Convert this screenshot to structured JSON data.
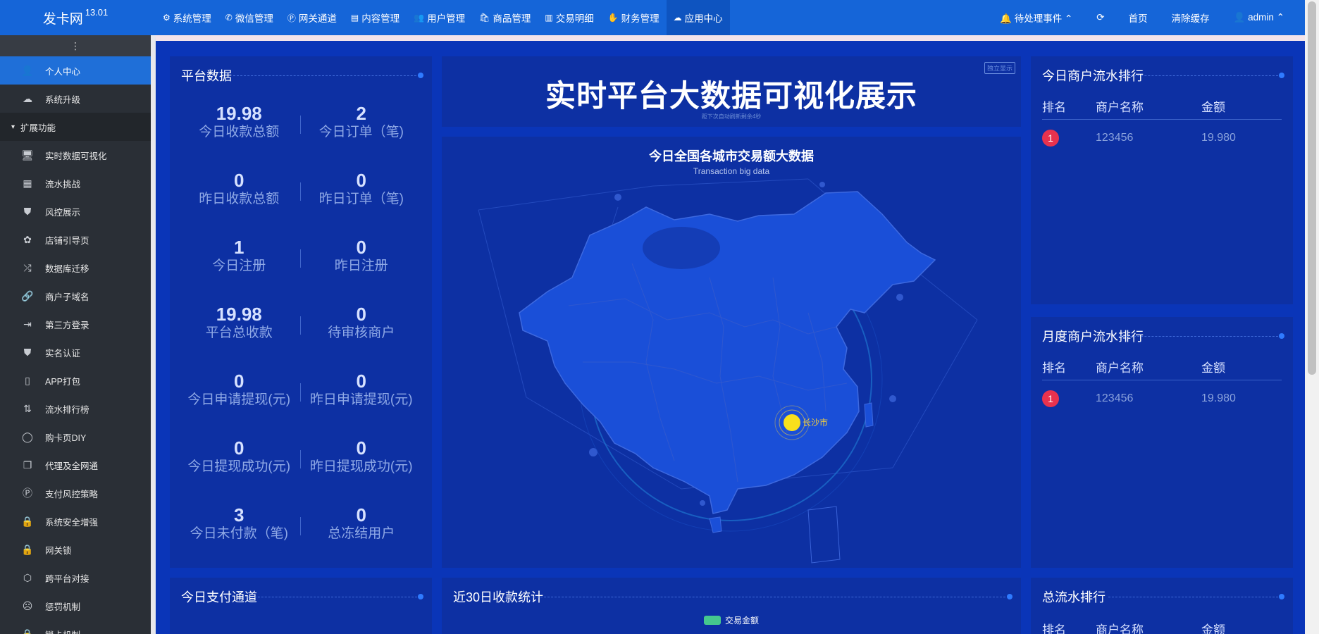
{
  "brand": {
    "name": "发卡网",
    "version": "13.01"
  },
  "topnav": [
    {
      "icon": "⚙",
      "label": "系统管理"
    },
    {
      "icon": "✆",
      "label": "微信管理"
    },
    {
      "icon": "Ⓟ",
      "label": "网关通道"
    },
    {
      "icon": "▤",
      "label": "内容管理"
    },
    {
      "icon": "👥",
      "label": "用户管理"
    },
    {
      "icon": "🛍",
      "label": "商品管理"
    },
    {
      "icon": "▥",
      "label": "交易明细"
    },
    {
      "icon": "✋",
      "label": "财务管理"
    },
    {
      "icon": "☁",
      "label": "应用中心"
    }
  ],
  "topright": [
    {
      "label": "🔔 待处理事件 ⌃"
    },
    {
      "label": "⟳"
    },
    {
      "label": "首页"
    },
    {
      "label": "清除缓存"
    },
    {
      "label": "👤 admin ⌃"
    }
  ],
  "sidebar": {
    "collapse_icon": "⋮",
    "items": [
      {
        "icon": "👤",
        "label": "个人中心"
      },
      {
        "icon": "☁",
        "label": "系统升级"
      },
      {
        "icon": "▾",
        "label": "扩展功能"
      },
      {
        "icon": "🖥",
        "label": "实时数据可视化"
      },
      {
        "icon": "▦",
        "label": "流水挑战"
      },
      {
        "icon": "⛊",
        "label": "风控展示"
      },
      {
        "icon": "✿",
        "label": "店铺引导页"
      },
      {
        "icon": "⤮",
        "label": "数据库迁移"
      },
      {
        "icon": "🔗",
        "label": "商户子域名"
      },
      {
        "icon": "⇥",
        "label": "第三方登录"
      },
      {
        "icon": "⛊",
        "label": "实名认证"
      },
      {
        "icon": "▯",
        "label": "APP打包"
      },
      {
        "icon": "⇅",
        "label": "流水排行榜"
      },
      {
        "icon": "◯",
        "label": "购卡页DIY"
      },
      {
        "icon": "❐",
        "label": "代理及全网通"
      },
      {
        "icon": "Ⓟ",
        "label": "支付风控策略"
      },
      {
        "icon": "🔒",
        "label": "系统安全增强"
      },
      {
        "icon": "🔒",
        "label": "网关锁"
      },
      {
        "icon": "⬡",
        "label": "跨平台对接"
      },
      {
        "icon": "☹",
        "label": "惩罚机制"
      },
      {
        "icon": "🔒",
        "label": "锁卡机制"
      }
    ]
  },
  "platform": {
    "title": "平台数据",
    "stats": [
      [
        {
          "value": "19.98",
          "label": "今日收款总额"
        },
        {
          "value": "2",
          "label": "今日订单（笔)"
        }
      ],
      [
        {
          "value": "0",
          "label": "昨日收款总额"
        },
        {
          "value": "0",
          "label": "昨日订单（笔)"
        }
      ],
      [
        {
          "value": "1",
          "label": "今日注册"
        },
        {
          "value": "0",
          "label": "昨日注册"
        }
      ],
      [
        {
          "value": "19.98",
          "label": "平台总收款"
        },
        {
          "value": "0",
          "label": "待审核商户"
        }
      ],
      [
        {
          "value": "0",
          "label": "今日申请提现(元)"
        },
        {
          "value": "0",
          "label": "昨日申请提现(元)"
        }
      ],
      [
        {
          "value": "0",
          "label": "今日提现成功(元)"
        },
        {
          "value": "0",
          "label": "昨日提现成功(元)"
        }
      ],
      [
        {
          "value": "3",
          "label": "今日未付款（笔)"
        },
        {
          "value": "0",
          "label": "总冻结用户"
        }
      ]
    ]
  },
  "bigscreen": {
    "title": "实时平台大数据可视化展示",
    "subtitle": "距下次自动刷新剩余4秒",
    "button": "独立显示"
  },
  "map": {
    "title": "今日全国各城市交易额大数据",
    "subtitle": "Transaction big data",
    "city": "长沙市"
  },
  "today_rank": {
    "title": "今日商户流水排行",
    "headers": [
      "排名",
      "商户名称",
      "金额"
    ],
    "rows": [
      {
        "rank": "1",
        "name": "123456",
        "amount": "19.980"
      }
    ]
  },
  "month_rank": {
    "title": "月度商户流水排行",
    "headers": [
      "排名",
      "商户名称",
      "金额"
    ],
    "rows": [
      {
        "rank": "1",
        "name": "123456",
        "amount": "19.980"
      }
    ]
  },
  "today_channel": {
    "title": "今日支付通道"
  },
  "last30": {
    "title": "近30日收款统计",
    "legend": "交易金额",
    "legend_color": "#45c88e"
  },
  "total_rank": {
    "title": "总流水排行",
    "headers": [
      "排名",
      "商户名称",
      "金额"
    ]
  }
}
